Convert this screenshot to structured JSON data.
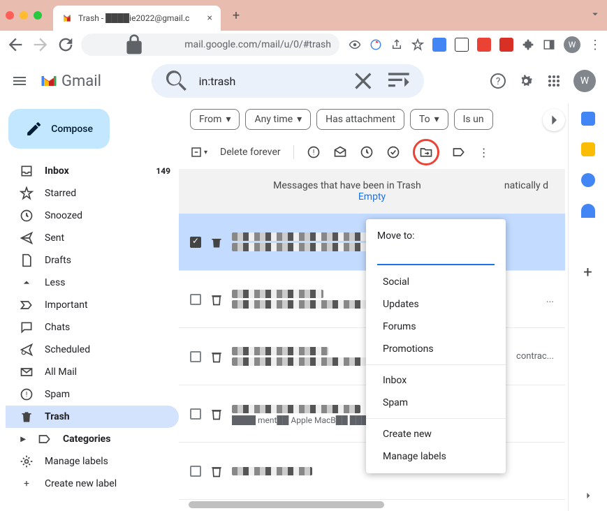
{
  "browser": {
    "tab_title": "Trash - ████ie2022@gmail.c",
    "url": "mail.google.com/mail/u/0/#trash",
    "avatar_letter": "W"
  },
  "header": {
    "app_name": "Gmail",
    "search_value": "in:trash",
    "avatar_letter": "W"
  },
  "sidebar": {
    "compose": "Compose",
    "items": [
      {
        "label": "Inbox",
        "count": "149"
      },
      {
        "label": "Starred"
      },
      {
        "label": "Snoozed"
      },
      {
        "label": "Sent"
      },
      {
        "label": "Drafts"
      },
      {
        "label": "Less"
      },
      {
        "label": "Important"
      },
      {
        "label": "Chats"
      },
      {
        "label": "Scheduled"
      },
      {
        "label": "All Mail"
      },
      {
        "label": "Spam"
      },
      {
        "label": "Trash"
      },
      {
        "label": "Categories"
      },
      {
        "label": "Manage labels"
      },
      {
        "label": "Create new label"
      }
    ]
  },
  "chips": {
    "from": "From",
    "anytime": "Any time",
    "hasatt": "Has attachment",
    "to": "To",
    "isunread": "Is un"
  },
  "toolbar": {
    "delete_forever": "Delete forever"
  },
  "banner": {
    "text_1": "Messages that have been in Trash ",
    "text_2": "natically d",
    "empty_link": "Empty"
  },
  "popup": {
    "title": "Move to:",
    "sections": [
      [
        "Social",
        "Updates",
        "Forums",
        "Promotions"
      ],
      [
        "Inbox",
        "Spam"
      ],
      [
        "Create new",
        "Manage labels"
      ]
    ]
  },
  "emails": {
    "snippet_3": "contrac..."
  }
}
